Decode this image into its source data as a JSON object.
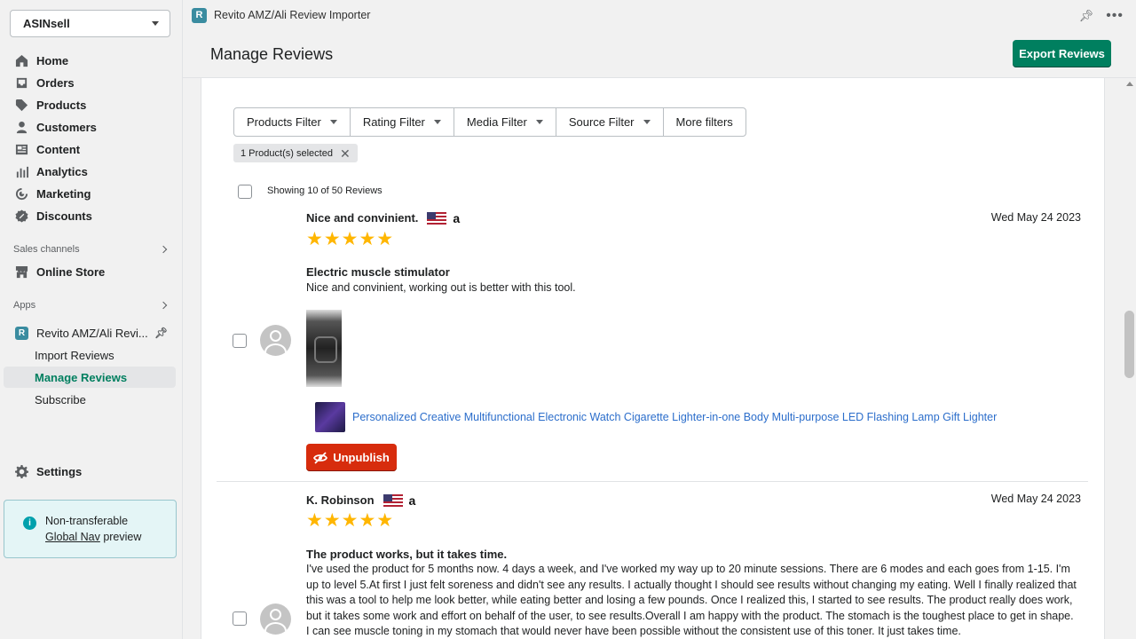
{
  "store": {
    "name": "ASINsell"
  },
  "nav": {
    "items": [
      {
        "label": "Home",
        "icon": "home-icon"
      },
      {
        "label": "Orders",
        "icon": "orders-icon"
      },
      {
        "label": "Products",
        "icon": "tag-icon"
      },
      {
        "label": "Customers",
        "icon": "person-icon"
      },
      {
        "label": "Content",
        "icon": "content-icon"
      },
      {
        "label": "Analytics",
        "icon": "analytics-icon"
      },
      {
        "label": "Marketing",
        "icon": "marketing-icon"
      },
      {
        "label": "Discounts",
        "icon": "discount-icon"
      }
    ],
    "sales_channels_label": "Sales channels",
    "online_store": "Online Store",
    "apps_label": "Apps",
    "app_name": "Revito AMZ/Ali Revi...",
    "app_sub": [
      "Import Reviews",
      "Manage Reviews",
      "Subscribe"
    ],
    "settings": "Settings"
  },
  "notice": {
    "line1": "Non-transferable",
    "link": "Global Nav",
    "line2": " preview"
  },
  "topbar": {
    "logo": "R",
    "title": "Revito AMZ/Ali Review Importer"
  },
  "page": {
    "title": "Manage Reviews",
    "export_label": "Export Reviews"
  },
  "filters": [
    "Products Filter",
    "Rating Filter",
    "Media Filter",
    "Source Filter",
    "More filters"
  ],
  "selected_tag": "1 Product(s) selected",
  "showing": "Showing 10 of 50 Reviews",
  "reviews": [
    {
      "name": "Nice and convinient.",
      "amz": "a",
      "stars": "★★★★★",
      "date": "Wed May 24 2023",
      "title": "Electric muscle stimulator",
      "body": "Nice and convinient, working out is better with this tool.",
      "product": "Personalized Creative Multifunctional Electronic Watch Cigarette Lighter-in-one Body Multi-purpose LED Flashing Lamp Gift Lighter",
      "unpublish": "Unpublish"
    },
    {
      "name": "K. Robinson",
      "amz": "a",
      "stars": "★★★★★",
      "date": "Wed May 24 2023",
      "title": "The product works, but it takes time.",
      "body": "I've used the product for 5 months now. 4 days a week, and I've worked my way up to 20 minute sessions. There are 6 modes and each goes from 1-15. I'm up to level 5.At first I just felt soreness and didn't see any results. I actually thought I should see results without changing my eating.  Well I finally realized that this was a tool to help me look better, while eating better and losing a few pounds.  Once I realized this, I started to see results. The product really does work, but it takes some work and effort on behalf of the user, to see results.Overall I am happy with the product. The stomach is the toughest place to get in shape. I can see muscle toning in my stomach that would never have been possible without the consistent use of this toner. It just takes time."
    }
  ],
  "colors": {
    "primary": "#007f5f",
    "critical": "#d72c0d",
    "link": "#2c6ecb",
    "star": "#ffb600"
  }
}
